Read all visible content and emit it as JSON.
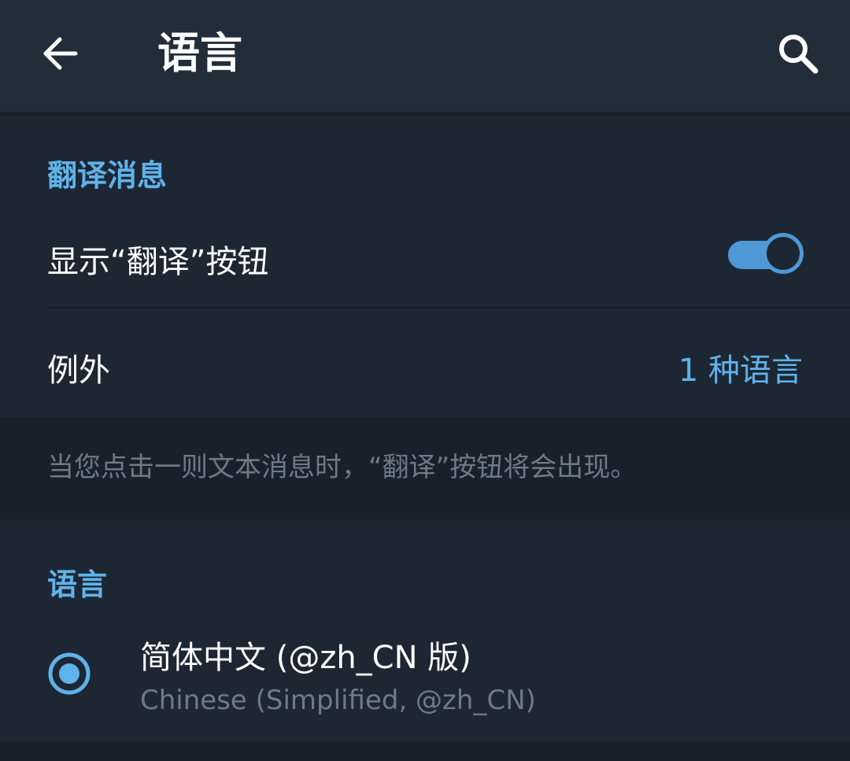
{
  "header": {
    "back_icon": "arrow-left-icon",
    "title": "语言",
    "search_icon": "search-icon"
  },
  "translate_section": {
    "header": "翻译消息",
    "show_button": {
      "label": "显示“翻译”按钮",
      "enabled": true
    },
    "exceptions": {
      "label": "例外",
      "value": "1 种语言"
    },
    "hint": "当您点击一则文本消息时，“翻译”按钮将会出现。"
  },
  "language_section": {
    "header": "语言",
    "items": [
      {
        "name": "简体中文 (@zh_CN 版)",
        "subtitle": "Chinese (Simplified, @zh_CN)",
        "selected": true
      }
    ]
  },
  "colors": {
    "accent": "#5fb3ea",
    "toggle": "#4f98d6",
    "background": "#18212b",
    "surface": "#1d2733",
    "toolbar": "#222d3a",
    "secondary_text": "#6c7a89"
  }
}
